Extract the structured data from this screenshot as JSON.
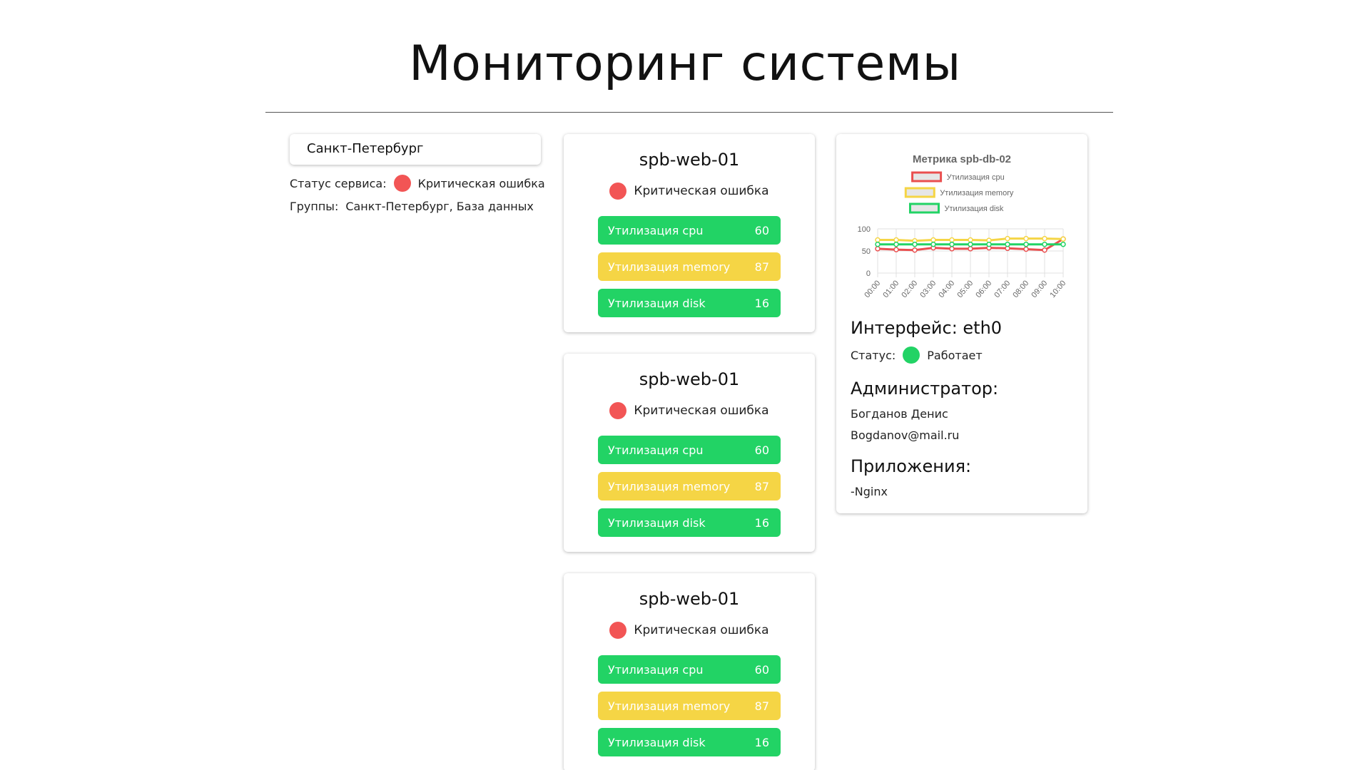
{
  "page_title": "Мониторинг системы",
  "filter": {
    "value": "Санкт-Петербург"
  },
  "service": {
    "status_label": "Статус сервиса:",
    "status_value": "Критическая ошибка",
    "status_color": "#f25555",
    "groups_label": "Группы:",
    "groups_value": "Санкт-Петербург, База данных"
  },
  "hosts": [
    {
      "name": "spb-web-01",
      "status": "Критическая ошибка",
      "status_color": "#f25555",
      "metrics": [
        {
          "label": "Утилизация cpu",
          "value": "60",
          "color": "#22d365"
        },
        {
          "label": "Утилизация memory",
          "value": "87",
          "color": "#f5d545"
        },
        {
          "label": "Утилизация disk",
          "value": "16",
          "color": "#22d365"
        }
      ]
    },
    {
      "name": "spb-web-01",
      "status": "Критическая ошибка",
      "status_color": "#f25555",
      "metrics": [
        {
          "label": "Утилизация cpu",
          "value": "60",
          "color": "#22d365"
        },
        {
          "label": "Утилизация memory",
          "value": "87",
          "color": "#f5d545"
        },
        {
          "label": "Утилизация disk",
          "value": "16",
          "color": "#22d365"
        }
      ]
    },
    {
      "name": "spb-web-01",
      "status": "Критическая ошибка",
      "status_color": "#f25555",
      "metrics": [
        {
          "label": "Утилизация cpu",
          "value": "60",
          "color": "#22d365"
        },
        {
          "label": "Утилизация memory",
          "value": "87",
          "color": "#f5d545"
        },
        {
          "label": "Утилизация disk",
          "value": "16",
          "color": "#22d365"
        }
      ]
    }
  ],
  "detail": {
    "interface_title": "Интерфейс: eth0",
    "status_label": "Статус:",
    "status_value": "Работает",
    "status_color": "#22d365",
    "admin_title": "Администратор:",
    "admin_name": "Богданов Денис",
    "admin_email": "Bogdanov@mail.ru",
    "apps_title": "Приложения:",
    "apps": [
      "-Nginx"
    ]
  },
  "chart_data": {
    "type": "line",
    "title": "Метрика spb-db-02",
    "categories": [
      "00:00",
      "01:00",
      "02:00",
      "03:00",
      "04:00",
      "05:00",
      "06:00",
      "07:00",
      "08:00",
      "09:00",
      "10:00"
    ],
    "ylim": [
      0,
      100
    ],
    "yticks": [
      0,
      50,
      100
    ],
    "grid": true,
    "legend_position": "top",
    "series": [
      {
        "name": "Утилизация cpu",
        "color": "#ea4f4f",
        "values": [
          55,
          53,
          52,
          57,
          55,
          55,
          57,
          56,
          54,
          52,
          77
        ]
      },
      {
        "name": "Утилизация memory",
        "color": "#f5d545",
        "values": [
          75,
          75,
          73,
          75,
          75,
          75,
          74,
          78,
          78,
          78,
          77
        ]
      },
      {
        "name": "Утилизация disk",
        "color": "#22d365",
        "values": [
          65,
          65,
          65,
          65,
          65,
          65,
          65,
          65,
          65,
          65,
          65
        ]
      }
    ]
  }
}
